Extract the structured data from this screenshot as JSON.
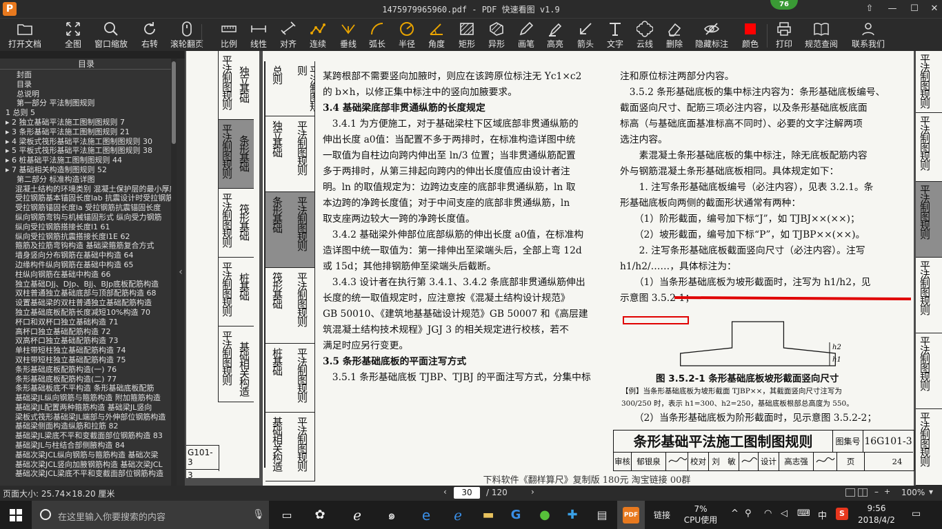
{
  "window": {
    "title": "1475979965960.pdf - PDF 快速看图 v1.9",
    "logo": "P",
    "badge": "76",
    "controls": [
      "⇧",
      "—",
      "☐",
      "✕"
    ]
  },
  "toolbar": [
    {
      "label": "打开文档",
      "icon": "folder-icon"
    },
    {
      "label": "全图",
      "icon": "fit-icon"
    },
    {
      "label": "窗口缩放",
      "icon": "zoom-icon"
    },
    {
      "label": "右转",
      "icon": "rotate-icon"
    },
    {
      "label": "滚轮翻页",
      "icon": "mouse-icon"
    },
    {
      "label": "比例",
      "icon": "scale-icon"
    },
    {
      "label": "线性",
      "icon": "linear-icon"
    },
    {
      "label": "对齐",
      "icon": "align-icon"
    },
    {
      "label": "连续",
      "icon": "continuous-icon"
    },
    {
      "label": "垂线",
      "icon": "perpendicular-icon"
    },
    {
      "label": "弧长",
      "icon": "arc-icon"
    },
    {
      "label": "半径",
      "icon": "radius-icon"
    },
    {
      "label": "角度",
      "icon": "angle-icon"
    },
    {
      "label": "矩形",
      "icon": "rectangle-icon"
    },
    {
      "label": "异形",
      "icon": "polygon-icon"
    },
    {
      "label": "画笔",
      "icon": "pen-icon"
    },
    {
      "label": "高亮",
      "icon": "highlight-icon"
    },
    {
      "label": "箭头",
      "icon": "arrow-icon"
    },
    {
      "label": "文字",
      "icon": "text-icon"
    },
    {
      "label": "云线",
      "icon": "cloud-icon"
    },
    {
      "label": "删除",
      "icon": "eraser-icon"
    },
    {
      "label": "隐藏标注",
      "icon": "hide-icon"
    },
    {
      "label": "颜色",
      "icon": "color-icon",
      "color": "#ff0000"
    },
    {
      "label": "打印",
      "icon": "print-icon"
    },
    {
      "label": "规范查阅",
      "icon": "book-icon"
    },
    {
      "label": "联系我们",
      "icon": "contact-icon"
    }
  ],
  "sidebar": {
    "header": "目录",
    "items": [
      "封面",
      "目录",
      "总说明",
      "第一部分  平法制图规则",
      "1  总则  5",
      "▸ 2  独立基础平法施工图制图规则  7",
      "▸ 3  条形基础平法施工图制图规则  21",
      "▸ 4  梁板式筏形基础平法施工图制图规则  30",
      "▸ 5  平板式筏形基础平法施工图制图规则  38",
      "▸ 6  桩基础平法施工图制图规则  44",
      "▸ 7  基础相关构造制图规则  52",
      "第二部分  标准构造详图",
      "混凝土结构的环境类别  混凝土保护层的最小厚度",
      "受拉钢筋基本锚固长度lab  抗震设计时受拉钢筋",
      "受拉钢筋锚固长度la  受拉钢筋抗震锚固长度",
      "纵向钢筋弯钩与机械锚固形式  纵向受力钢筋",
      "纵向受拉钢筋搭接长度l1  61",
      "纵向受拉钢筋抗震搭接长度l1E  62",
      "箍筋及拉筋弯钩构造  基础梁箍筋复合方式",
      "墙身竖向分布钢筋在基础中构造  64",
      "边缘构件纵向钢筋在基础中构造  65",
      "柱纵向钢筋在基础中构造  66",
      "独立基础DJj、DJp、BJj、BJp底板配筋构造",
      "双柱普通独立基础底部与顶部配筋构造  68",
      "设置基础梁的双柱普通独立基础配筋构造",
      "独立基础底板配筋长度减短10%构造  70",
      "杯口和双杯口独立基础构造  71",
      "高杯口独立基础配筋构造  72",
      "双高杯口独立基础配筋构造  73",
      "单柱带短柱独立基础配筋构造  74",
      "双柱带短柱独立基础配筋构造  75",
      "条形基础底板配筋构造(一)  76",
      "条形基础底板配筋构造(二)  77",
      "条形基础板底不平构造  条形基础底板配筋",
      "基础梁JL纵向钢筋与箍筋构造  附加箍筋构造",
      "基础梁JL配置两种箍筋构造  基础梁JL竖向",
      "梁板式筏形基础梁JL端部与外伸部位钢筋构造",
      "基础梁侧面构造纵筋和拉筋  82",
      "基础梁JL梁底不平和变截面部位钢筋构造  83",
      "基础梁JL与柱结合部侧腋构造  84",
      "基础次梁JCL纵向钢筋与箍筋构造  基础次梁",
      "基础次梁JCL竖向加腋钢筋构造  基础次梁JCL",
      "基础次梁JCL梁底不平和变截面部位钢筋构造"
    ]
  },
  "tabs_left": [
    {
      "text": "平法制图规则"
    },
    {
      "text": "独立基础"
    },
    {
      "text": "平法制图规则"
    },
    {
      "text": "条形基础"
    },
    {
      "text": "平法制图规则"
    },
    {
      "text": "筏形基础"
    },
    {
      "text": "平法制图规则"
    },
    {
      "text": "桩基础"
    },
    {
      "text": "平法制图规则"
    },
    {
      "text": "基础相关构造"
    }
  ],
  "tabs_mid": [
    {
      "text": "总则"
    },
    {
      "text": "平法制图规则"
    },
    {
      "text": "独立基础"
    },
    {
      "text": "平法制图规则"
    },
    {
      "text": "条形基础"
    },
    {
      "text": "平法制图规则"
    },
    {
      "text": "筏形基础"
    },
    {
      "text": "平法制图规则"
    },
    {
      "text": "桩基础"
    },
    {
      "text": "平法制图规则"
    },
    {
      "text": "基础相关构造"
    },
    {
      "text": "平法制图规则"
    }
  ],
  "left_page_code": "G101-3",
  "left_page_num": "3",
  "col1": [
    {
      "t": "p",
      "text": "某跨根部不需要竖向加腋时，则应在该跨原位标注无 Yc1×c2"
    },
    {
      "t": "p",
      "text": "的 b×h，以修正集中标注中的竖向加腋要求。"
    },
    {
      "t": "h",
      "text": "3.4  基础梁底部非贯通纵筋的长度规定"
    },
    {
      "t": "p",
      "text": "　3.4.1 为方便施工，对于基础梁柱下区域底部非贯通纵筋的"
    },
    {
      "t": "p",
      "text": "伸出长度 a0值：当配置不多于两排时，在标准构造详图中统"
    },
    {
      "t": "p",
      "text": "一取值为自柱边向跨内伸出至 ln/3 位置；当非贯通纵筋配置"
    },
    {
      "t": "p",
      "text": "多于两排时，从第三排起向跨内的伸出长度值应由设计者注"
    },
    {
      "t": "p",
      "text": "明。ln 的取值规定为：边跨边支座的底部非贯通纵筋，ln 取"
    },
    {
      "t": "p",
      "text": "本边跨的净跨长度值；对于中间支座的底部非贯通纵筋，ln"
    },
    {
      "t": "p",
      "text": "取支座两边较大一跨的净跨长度值。"
    },
    {
      "t": "p",
      "text": "　3.4.2 基础梁外伸部位底部纵筋的伸出长度 a0值，在标准构"
    },
    {
      "t": "p",
      "text": "造详图中统一取值为：第一排伸出至梁端头后，全部上弯 12d"
    },
    {
      "t": "p",
      "text": "或 15d；其他排钢筋伸至梁端头后截断。"
    },
    {
      "t": "p",
      "text": "　3.4.3 设计者在执行第 3.4.1、3.4.2 条底部非贯通纵筋伸出"
    },
    {
      "t": "p",
      "text": "长度的统一取值规定时，应注意按《混凝土结构设计规范》"
    },
    {
      "t": "p",
      "text": "GB 50010、《建筑地基基础设计规范》GB 50007 和《高层建"
    },
    {
      "t": "p",
      "text": "筑混凝土结构技术规程》JGJ 3 的相关规定进行校核，若不"
    },
    {
      "t": "p",
      "text": "满足时应另行变更。"
    },
    {
      "t": "h",
      "text": "3.5  条形基础底板的平面注写方式"
    },
    {
      "t": "p",
      "text": "　3.5.1 条形基础底板 TJBP、TJBJ 的平面注写方式，分集中标"
    }
  ],
  "col2": [
    {
      "t": "p",
      "text": "注和原位标注两部分内容。"
    },
    {
      "t": "p",
      "text": "　3.5.2 条形基础底板的集中标注内容为：条形基础底板编号、"
    },
    {
      "t": "p",
      "text": "截面竖向尺寸、配筋三项必注内容，以及条形基础底板底面"
    },
    {
      "t": "p",
      "text": "标高（与基础底面基准标高不同时）、必要的文字注解两项"
    },
    {
      "t": "p",
      "text": "选注内容。"
    },
    {
      "t": "p",
      "text": "　　素混凝土条形基础底板的集中标注，除无底板配筋内容"
    },
    {
      "t": "p",
      "text": "外与钢筋混凝土条形基础底板相同。具体规定如下："
    },
    {
      "t": "p",
      "text": "　　1. 注写条形基础底板编号（必注内容），见表 3.2.1。条"
    },
    {
      "t": "p",
      "text": "形基础底板向两侧的截面形状通常有两种："
    },
    {
      "t": "p",
      "text": "　　（1）阶形截面，编号加下标“J”，如 TJBJ××(××)；"
    },
    {
      "t": "p",
      "text": "　　（2）坡形截面，编号加下标“P”，如 TJBP××(××)。"
    },
    {
      "t": "p",
      "text": "　　2. 注写条形基础底板截面竖向尺寸（必注内容）。注写"
    },
    {
      "t": "p",
      "text": "h1/h2/……，具体标注为："
    },
    {
      "t": "p",
      "text": "　　（1）当条形基础底板为坡形截面时，注写为 h1/h2，见"
    },
    {
      "t": "p",
      "text": "示意图 3.5.2-1；"
    }
  ],
  "figure": {
    "caption": "图 3.5.2-1  条形基础底板坡形截面竖向尺寸",
    "note1": "【例】当条形基础底板为坡形截面 TJBP××，其截面竖向尺寸注写为",
    "note2": "300/250 时，表示 h1=300、h2=250，基础底板根部总高度为 550。",
    "h1": "h1",
    "h2": "h2"
  },
  "col2_after": "　　（2）当条形基础底板为阶形截面时，见示意图 3.5.2-2；",
  "title_block": {
    "title": "条形基础平法施工图制图规则",
    "atlas_label": "图集号",
    "atlas_no": "16G101-3",
    "row2": [
      "审核",
      "郁银泉",
      "校对",
      "刘　敏",
      "设计",
      "高志强",
      "页",
      "24"
    ]
  },
  "page_footer": "下料软件《翻样算尺》复制版  180元  淘宝链接  00群",
  "tabs_right": [
    {
      "text": "平法制图规则"
    },
    {
      "text": "平法制图规则"
    },
    {
      "text": "平法制图规则"
    },
    {
      "text": "平法制图规则"
    },
    {
      "text": "平法制图规则"
    },
    {
      "text": "平法制图规则"
    }
  ],
  "statusbar": {
    "page_size": "页面大小: 25.74×18.20 厘米",
    "current_page": "30",
    "total_pages": "/ 120",
    "zoom": "100%"
  },
  "taskbar": {
    "search_placeholder": "在这里输入你要搜索的内容",
    "link": "链接",
    "cpu_pct": "7%",
    "cpu_label": "CPU使用",
    "ime": "中",
    "time": "9:56",
    "date": "2018/4/2"
  },
  "annotation_color": "#e00000"
}
